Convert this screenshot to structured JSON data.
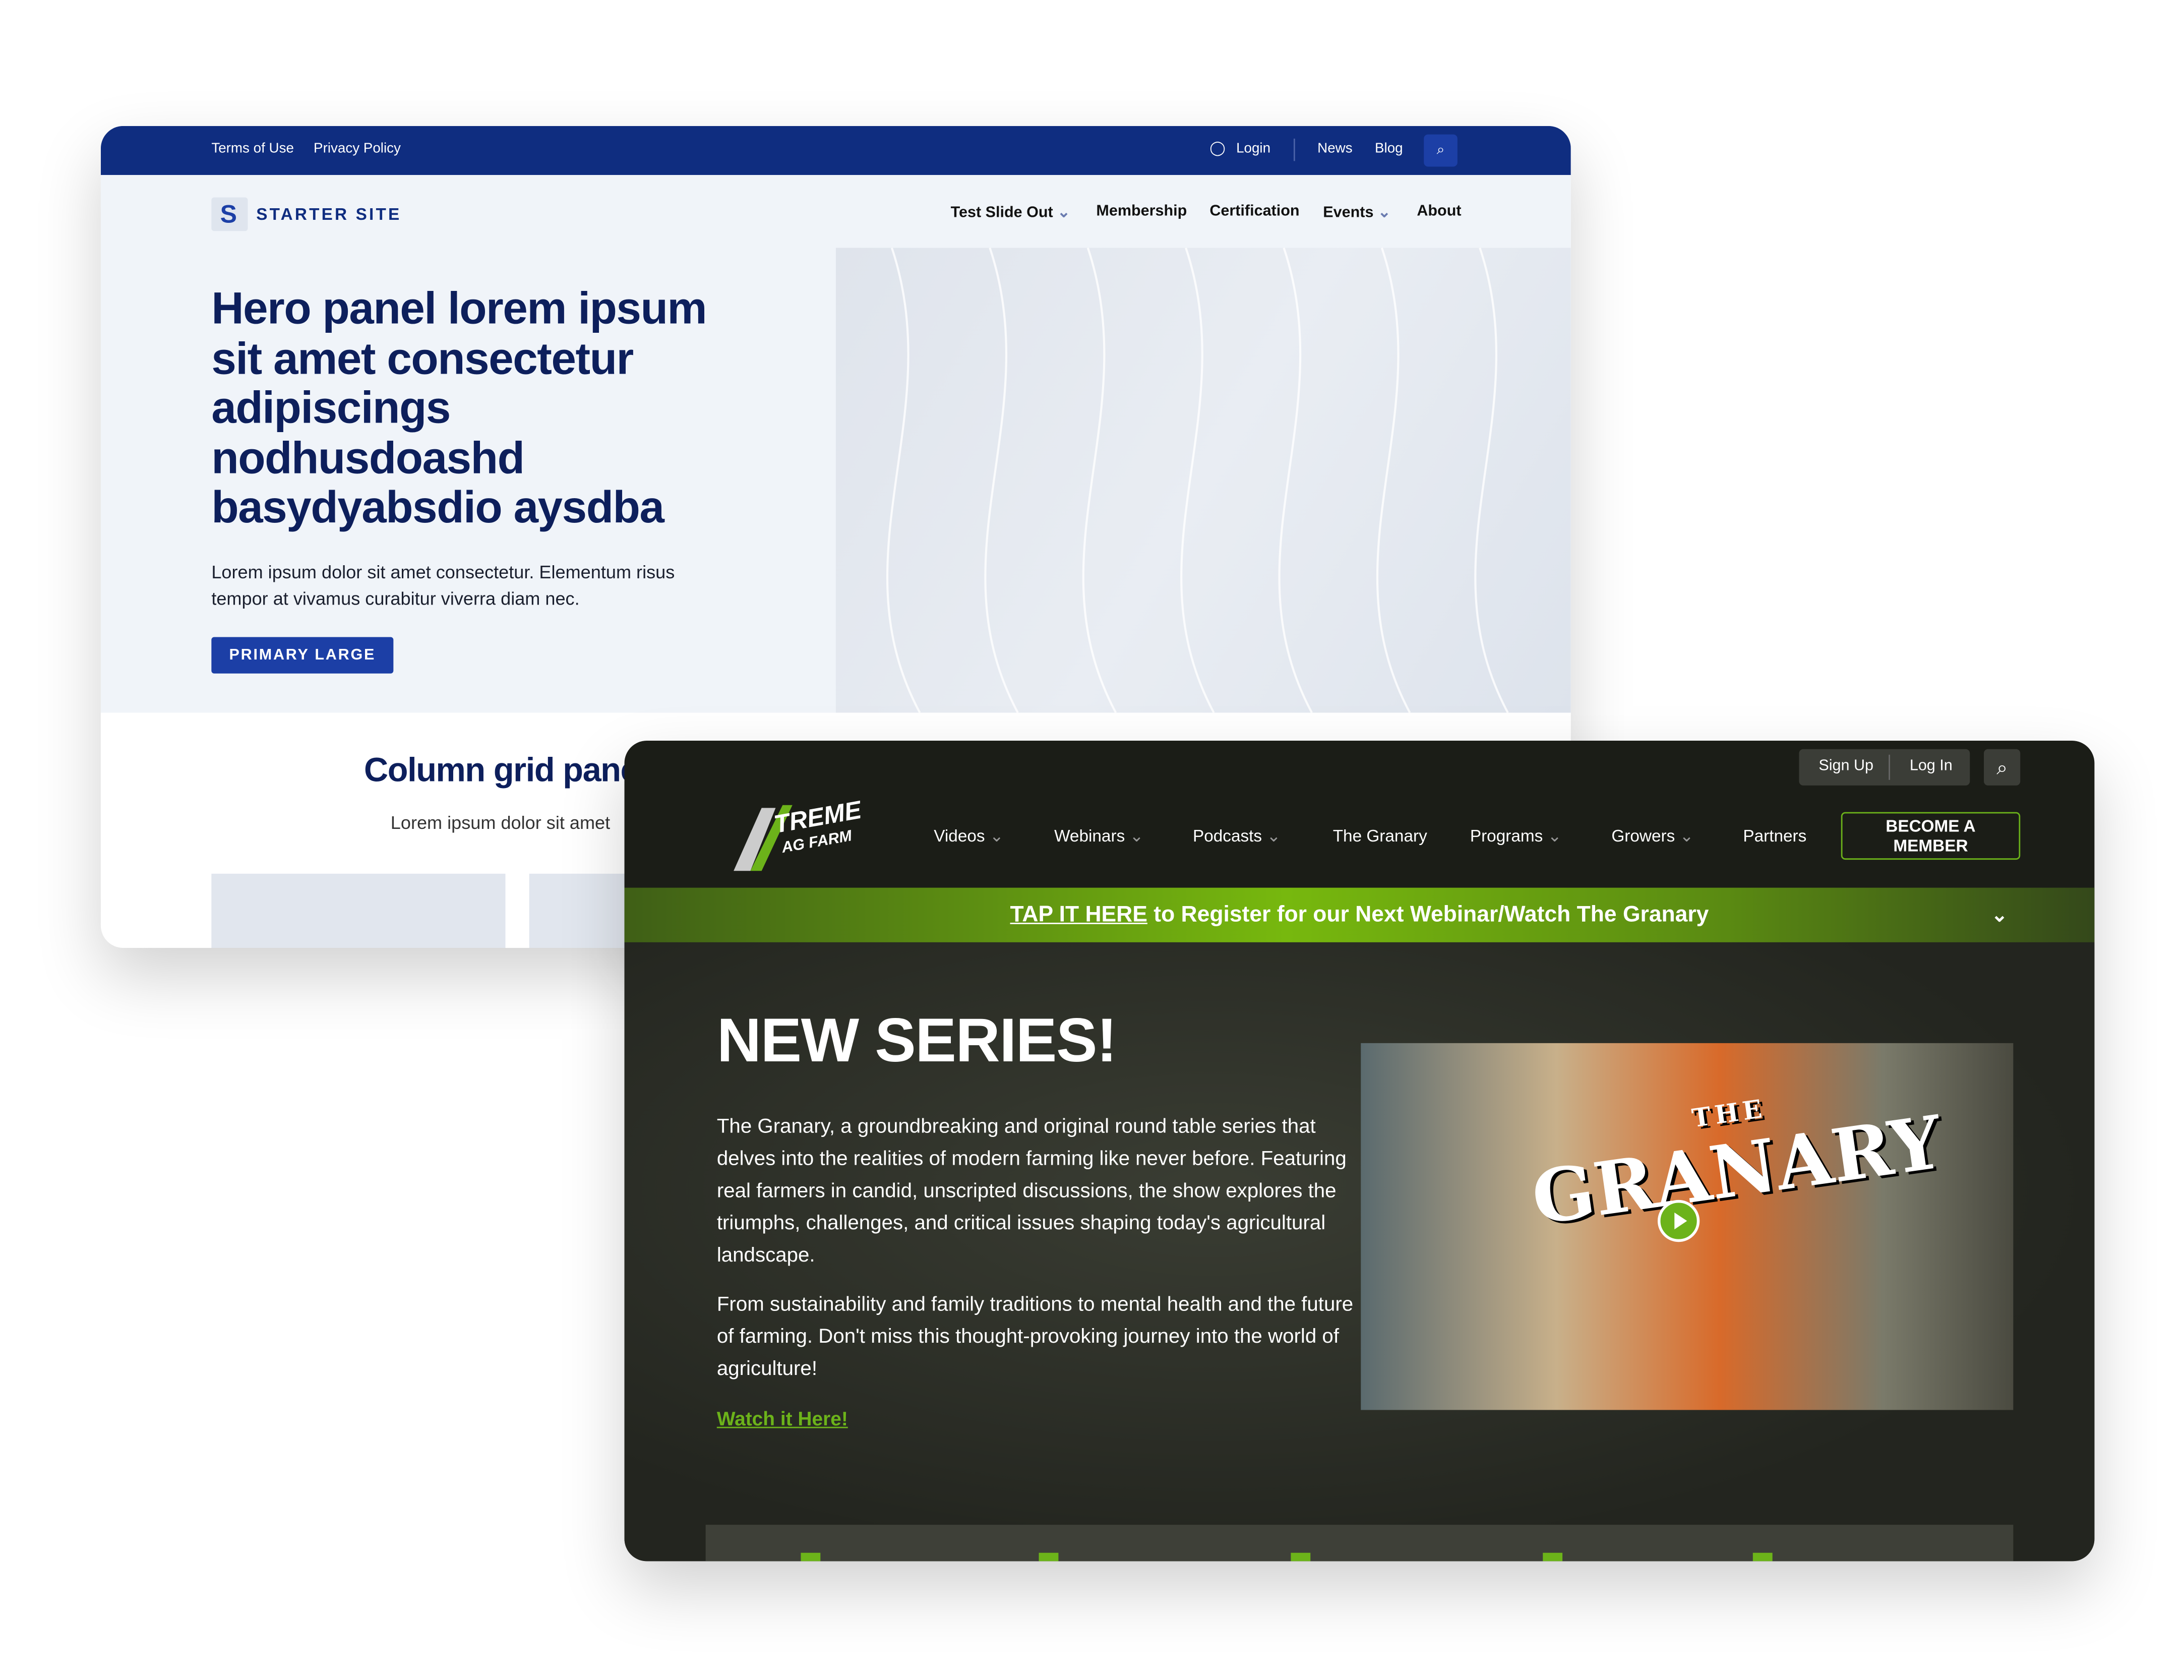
{
  "starter": {
    "top_links": [
      "Terms of Use",
      "Privacy Policy"
    ],
    "login": "Login",
    "news": "News",
    "blog": "Blog",
    "logo_text": "STARTER SITE",
    "nav": [
      "Test Slide Out",
      "Membership",
      "Certification",
      "Events",
      "About"
    ],
    "hero_title": "Hero panel lorem ipsum sit amet consectetur adipiscings nodhusdoashd basydyabsdio aysdba",
    "hero_text": "Lorem ipsum dolor sit amet consectetur. Elementum risus tempor at vivamus curabitur viverra diam nec.",
    "cta": "PRIMARY LARGE",
    "column_title": "Column grid panel",
    "column_sub": "Lorem ipsum dolor sit amet",
    "accent": "#1c3fa6"
  },
  "xtreme": {
    "logo_text": "XTREME AG FARM",
    "sign_up": "Sign Up",
    "log_in": "Log In",
    "nav": [
      "Videos",
      "Webinars",
      "Podcasts",
      "The Granary",
      "Programs",
      "Growers",
      "Partners"
    ],
    "member_button": "BECOME A MEMBER",
    "banner_link": "TAP IT HERE",
    "banner_text": " to Register for our Next Webinar/Watch The Granary",
    "hero_title": "NEW SERIES!",
    "para1": "The Granary, a groundbreaking and original round table series that delves into the realities of modern farming like never before. Featuring real farmers in candid, unscripted discussions, the show explores the triumphs, challenges, and critical issues shaping today's agricultural landscape.",
    "para2": "From sustainability and family traditions to mental health and the future of farming. Don't miss this thought-provoking journey into the world of agriculture!",
    "watch_link": "Watch it Here!",
    "video_title_small": "THE",
    "video_title": "GRANARY",
    "accent": "#6cb31a"
  }
}
